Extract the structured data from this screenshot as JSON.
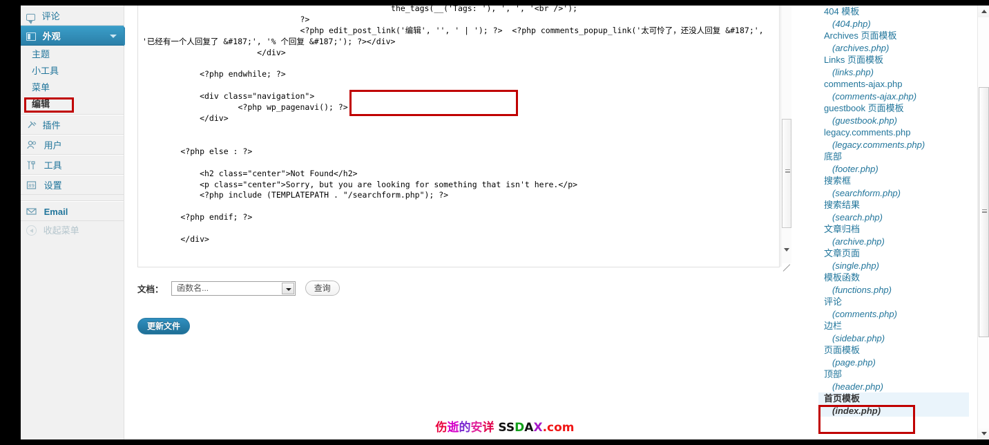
{
  "sidebar": {
    "items": [
      {
        "label": "评论",
        "icon": "comment-icon"
      },
      {
        "label": "外观",
        "icon": "appearance-icon",
        "current": true
      },
      {
        "label": "插件",
        "icon": "plugin-icon"
      },
      {
        "label": "用户",
        "icon": "user-icon"
      },
      {
        "label": "工具",
        "icon": "tools-icon"
      },
      {
        "label": "设置",
        "icon": "settings-icon"
      },
      {
        "label": "Email",
        "icon": "email-icon"
      }
    ],
    "submenu": [
      {
        "label": "主题"
      },
      {
        "label": "小工具"
      },
      {
        "label": "菜单"
      },
      {
        "label": "编辑",
        "current": true,
        "highlighted": true
      }
    ],
    "collapse_label": "收起菜单"
  },
  "editor": {
    "code": "                                                    the_tags(__('Tags: '), ', ', '<br />');\n                                 ?>\n                                 <?php edit_post_link('编辑', '', ' | '); ?>  <?php comments_popup_link('太可怜了，还没人回复 &#187;',\n'已经有一个人回复了 &#187;', '% 个回复 &#187;'); ?></div>\n                        </div>\n\n            <?php endwhile; ?>\n\n            <div class=\"navigation\">\n                    <?php wp_pagenavi(); ?>\n            </div>\n\n\n        <?php else : ?>\n\n            <h2 class=\"center\">Not Found</h2>\n            <p class=\"center\">Sorry, but you are looking for something that isn't here.</p>\n            <?php include (TEMPLATEPATH . \"/searchform.php\"); ?>\n\n        <?php endif; ?>\n\n        </div>",
    "annotation_color": "#c00000"
  },
  "docs": {
    "label": "文档：",
    "select_value": "函数名...",
    "search_button": "查询"
  },
  "update_button": "更新文件",
  "filelist": [
    {
      "name": "404 模板",
      "path": "(404.php)"
    },
    {
      "name": "Archives 页面模板",
      "path": "(archives.php)"
    },
    {
      "name": "Links 页面模板",
      "path": "(links.php)"
    },
    {
      "name": "comments-ajax.php",
      "path": "(comments-ajax.php)"
    },
    {
      "name": "guestbook 页面模板",
      "path": "(guestbook.php)"
    },
    {
      "name": "legacy.comments.php",
      "path": "(legacy.comments.php)"
    },
    {
      "name": "底部",
      "path": "(footer.php)"
    },
    {
      "name": "搜索框",
      "path": "(searchform.php)"
    },
    {
      "name": "搜索结果",
      "path": "(search.php)"
    },
    {
      "name": "文章归档",
      "path": "(archive.php)"
    },
    {
      "name": "文章页面",
      "path": "(single.php)"
    },
    {
      "name": "模板函数",
      "path": "(functions.php)"
    },
    {
      "name": "评论",
      "path": "(comments.php)"
    },
    {
      "name": "边栏",
      "path": "(sidebar.php)"
    },
    {
      "name": "页面模板",
      "path": "(page.php)"
    },
    {
      "name": "顶部",
      "path": "(header.php)"
    },
    {
      "name": "首页模板",
      "path": "(index.php)",
      "selected": true
    }
  ],
  "watermark": {
    "parts": [
      {
        "text": "伤",
        "color": "#e8003c"
      },
      {
        "text": "逝",
        "color": "#d400c8"
      },
      {
        "text": "的",
        "color": "#7a2ad0"
      },
      {
        "text": "安",
        "color": "#e0229a"
      },
      {
        "text": "详",
        "color": "#e0004b"
      },
      {
        "text": " ",
        "color": "#000000"
      },
      {
        "text": "S",
        "color": "#111111"
      },
      {
        "text": "S",
        "color": "#111111"
      },
      {
        "text": "D",
        "color": "#12a01a"
      },
      {
        "text": "A",
        "color": "#111111"
      },
      {
        "text": "X",
        "color": "#a619c8"
      },
      {
        "text": ".com",
        "color": "#f01717"
      }
    ]
  },
  "accent_color": "#21759b"
}
